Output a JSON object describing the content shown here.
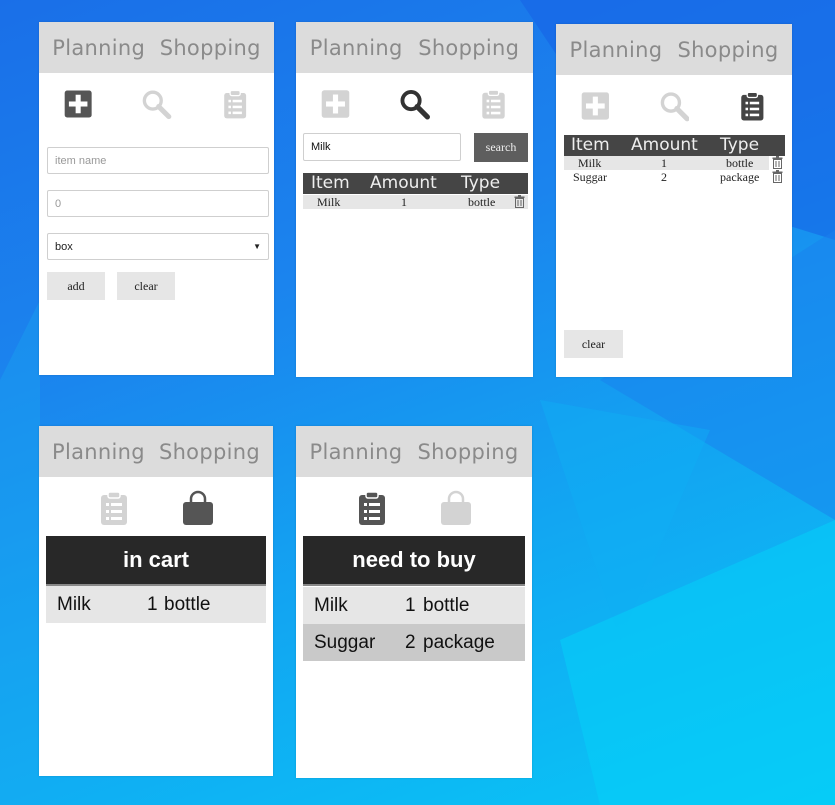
{
  "nav": {
    "planning": "Planning",
    "shopping": "Shopping"
  },
  "icons": {
    "add": "plus-square-icon",
    "search": "magnifier-icon",
    "list": "clipboard-list-icon",
    "cart": "shopping-bag-icon",
    "delete": "trash-icon",
    "dropdown": "caret-down-icon"
  },
  "colors": {
    "active_icon": "#555555",
    "inactive_icon": "#d3d3d3",
    "nav_bg": "#dcdcdc",
    "header_bg": "#282828"
  },
  "add_form": {
    "item_placeholder": "item name",
    "amount_placeholder": "0",
    "type_value": "box",
    "add_label": "add",
    "clear_label": "clear"
  },
  "search_view": {
    "query": "Milk",
    "search_label": "search",
    "columns": [
      "Item",
      "Amount",
      "Type"
    ],
    "rows": [
      {
        "item": "Milk",
        "amount": "1",
        "type": "bottle"
      }
    ]
  },
  "list_view": {
    "columns": [
      "Item",
      "Amount",
      "Type"
    ],
    "rows": [
      {
        "item": "Milk",
        "amount": "1",
        "type": "bottle"
      },
      {
        "item": "Suggar",
        "amount": "2",
        "type": "package"
      }
    ],
    "clear_label": "clear"
  },
  "cart_view": {
    "title": "in cart",
    "rows": [
      {
        "item": "Milk",
        "amount": "1",
        "type": "bottle"
      }
    ]
  },
  "buy_view": {
    "title": "need to buy",
    "rows": [
      {
        "item": "Milk",
        "amount": "1",
        "type": "bottle"
      },
      {
        "item": "Suggar",
        "amount": "2",
        "type": "package"
      }
    ]
  }
}
